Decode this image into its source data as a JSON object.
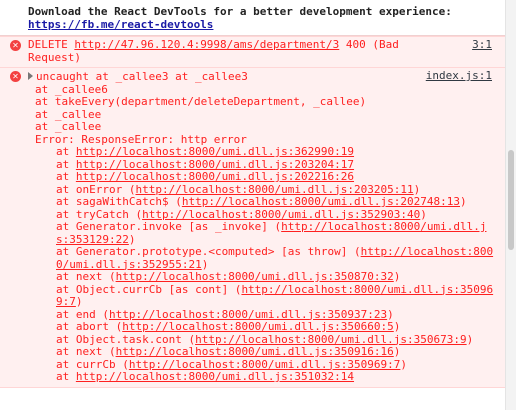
{
  "info": {
    "text": "Download the React DevTools for a better development experience: ",
    "link": "https://fb.me/react-devtools"
  },
  "error1": {
    "method": "DELETE ",
    "url": "http://47.96.120.4:9998/ams/department/3",
    "status": " 400 (Bad Request)",
    "source": "3:1"
  },
  "error2": {
    "head": "uncaught at _callee3 at _callee3",
    "source": "index.js:1",
    "saga_lines": [
      "at _callee6",
      "at takeEvery(department/deleteDepartment, _callee)",
      "at _callee",
      "at _callee",
      "Error: ResponseError: http error"
    ],
    "stack": [
      {
        "prefix": "at ",
        "url": "http://localhost:8000/umi.dll.js:362990:19",
        "suffix": ""
      },
      {
        "prefix": "at ",
        "url": "http://localhost:8000/umi.dll.js:203204:17",
        "suffix": ""
      },
      {
        "prefix": "at ",
        "url": "http://localhost:8000/umi.dll.js:202216:26",
        "suffix": ""
      },
      {
        "prefix": "at onError (",
        "url": "http://localhost:8000/umi.dll.js:203205:11",
        "suffix": ")"
      },
      {
        "prefix": "at sagaWithCatch$ (",
        "url": "http://localhost:8000/umi.dll.js:202748:13",
        "suffix": ")"
      },
      {
        "prefix": "at tryCatch (",
        "url": "http://localhost:8000/umi.dll.js:352903:40",
        "suffix": ")"
      },
      {
        "prefix": "at Generator.invoke [as _invoke] (",
        "url": "http://localhost:8000/umi.dll.js:353129:22",
        "suffix": ")"
      },
      {
        "prefix": "at Generator.prototype.<computed> [as throw] (",
        "url": "http://localhost:8000/umi.dll.js:352955:21",
        "suffix": ")"
      },
      {
        "prefix": "at next (",
        "url": "http://localhost:8000/umi.dll.js:350870:32",
        "suffix": ")"
      },
      {
        "prefix": "at Object.currCb [as cont] (",
        "url": "http://localhost:8000/umi.dll.js:350969:7",
        "suffix": ")"
      },
      {
        "prefix": "at end (",
        "url": "http://localhost:8000/umi.dll.js:350937:23",
        "suffix": ")"
      },
      {
        "prefix": "at abort (",
        "url": "http://localhost:8000/umi.dll.js:350660:5",
        "suffix": ")"
      },
      {
        "prefix": "at Object.task.cont (",
        "url": "http://localhost:8000/umi.dll.js:350673:9",
        "suffix": ")"
      },
      {
        "prefix": "at next (",
        "url": "http://localhost:8000/umi.dll.js:350916:16",
        "suffix": ")"
      },
      {
        "prefix": "at currCb (",
        "url": "http://localhost:8000/umi.dll.js:350969:7",
        "suffix": ")"
      },
      {
        "prefix": "at ",
        "url": "http://localhost:8000/umi.dll.js:351032:14",
        "suffix": ""
      }
    ]
  },
  "colors": {
    "error_text": "#fe2020",
    "error_bg": "#fff0f0",
    "link": "#1a1aa6"
  },
  "icons": {
    "error": "error-circle-icon",
    "expand": "triangle-right-icon"
  }
}
